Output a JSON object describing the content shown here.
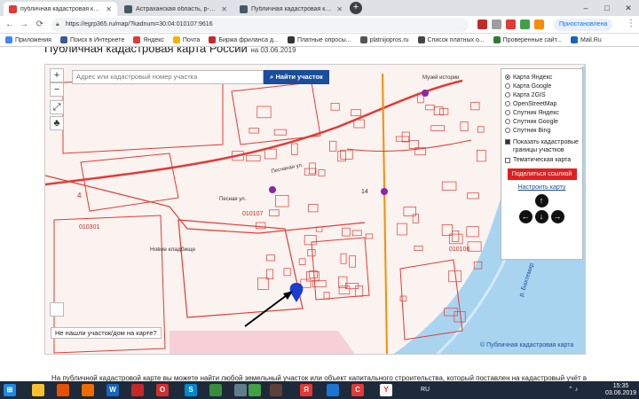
{
  "browser": {
    "tabs": [
      {
        "label": "публичная кадастровая карта -",
        "color": "#e53935",
        "active": true
      },
      {
        "label": "Астраханская область, р-н Икр",
        "color": "#455a64",
        "active": false
      },
      {
        "label": "Публичная кадастровая карта",
        "color": "#455a64",
        "active": false
      }
    ],
    "new_tab": "+",
    "window_controls": [
      "–",
      "□",
      "✕"
    ],
    "url": "https://egrp365.ru/map/?kadnum=30:04:010107:9616",
    "profile": "Приостановлена",
    "bookmarks": [
      {
        "label": "Приложения",
        "color": "#4285f4"
      },
      {
        "label": "Поиск в Интернете",
        "color": "#3b5998"
      },
      {
        "label": "Яндекс",
        "color": "#e53935"
      },
      {
        "label": "Почта",
        "color": "#f4b400"
      },
      {
        "label": "Биржа фриланса д...",
        "color": "#c62828"
      },
      {
        "label": "Платные опросы...",
        "color": "#333333"
      },
      {
        "label": "platnijopros.ru",
        "color": "#555555"
      },
      {
        "label": "Список платных о...",
        "color": "#444444"
      },
      {
        "label": "Проверенные сайт...",
        "color": "#2e7d32"
      },
      {
        "label": "Mail.Ru",
        "color": "#1565c0"
      }
    ]
  },
  "page": {
    "title": "Публичная кадастровая карта России",
    "title_date": "на 03.06.2019",
    "footer_text": "На публичной кадастровой карте вы можете найти любой земельный участок или объект капитального строительства, который поставлен на кадастровый учёт в"
  },
  "map": {
    "search_placeholder": "Адрес или кадастровый номер участка",
    "search_button": "Найти участок",
    "zoom_in": "+",
    "zoom_out": "−",
    "layers": [
      {
        "label": "Карта Яндекс",
        "selected": true
      },
      {
        "label": "Карта Google",
        "selected": false
      },
      {
        "label": "Карта 2GIS",
        "selected": false
      },
      {
        "label": "OpenStreetMap",
        "selected": false
      },
      {
        "label": "Спутник Яндекс",
        "selected": false
      },
      {
        "label": "Спутник Google",
        "selected": false
      },
      {
        "label": "Спутник Bing",
        "selected": false
      }
    ],
    "show_bounds_label": "Показать кадастровые границы участков",
    "show_bounds_checked": true,
    "thematic_label": "Тематическая карта",
    "thematic_checked": false,
    "share_button": "Поделиться ссылкой",
    "setup_link": "Настроить карту",
    "not_found": "Не нашли участок/дом на карте?",
    "copyright": "© Публичная кадастровая карта",
    "labels": {
      "quarter_1": "010107",
      "quarter_2": "010301",
      "quarter_3": "010106",
      "cemetery": "Новое кладбище",
      "street_1": "Песчаная ул.",
      "street_2": "Песная ул.",
      "river": "р. Бахтемир",
      "museum": "Музей истории",
      "num_14": "14",
      "num_4": "4"
    }
  },
  "taskbar": {
    "lang": "RU",
    "time": "15:35",
    "date": "03.06.2019"
  }
}
